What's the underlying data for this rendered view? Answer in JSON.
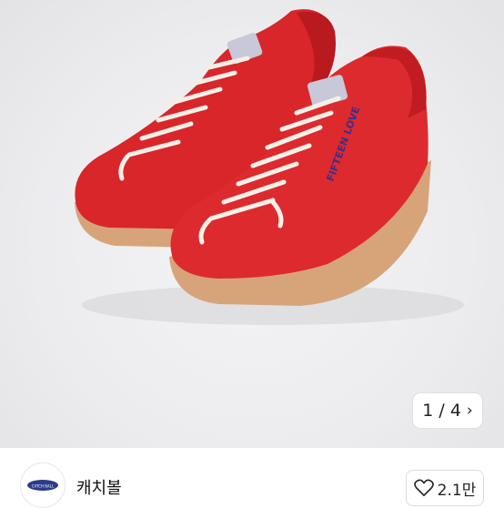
{
  "gallery": {
    "image_alt": "Red leather sneakers with gum sole",
    "shoe_text": "FIFTEEN LOVE",
    "counter": "1 / 4",
    "next_icon": "chevron-right-icon"
  },
  "seller": {
    "logo_text": "CATCH BALL",
    "name": "캐치볼"
  },
  "like": {
    "icon": "heart-icon",
    "count": "2.1만"
  },
  "colors": {
    "shoe_red": "#d8262b",
    "sole": "#d7a47a",
    "logo_blue": "#2c3c8a"
  }
}
